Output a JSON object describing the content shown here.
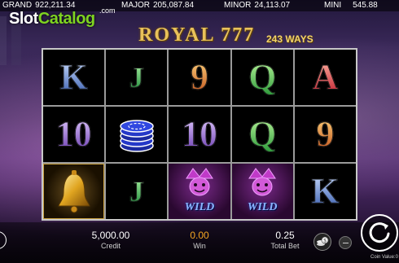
{
  "jackpots": [
    {
      "label": "GRAND",
      "value": "922,211.34"
    },
    {
      "label": "MAJOR",
      "value": "205,087.84"
    },
    {
      "label": "MINOR",
      "value": "24,113.07"
    },
    {
      "label": "MINI",
      "value": "545.88"
    }
  ],
  "logo": {
    "slot": "Slot",
    "catalog": "Catalog",
    "com": ".com"
  },
  "game": {
    "title": "ROYAL 777",
    "ways": "243 WAYS"
  },
  "reels": [
    [
      "K",
      "J",
      "9",
      "Q",
      "A"
    ],
    [
      "10",
      "chips",
      "10",
      "Q",
      "9"
    ],
    [
      "bell",
      "J",
      "WILD",
      "WILD",
      "K"
    ]
  ],
  "wild_label": "WILD",
  "bottom": {
    "credit_value": "5,000.00",
    "credit_label": "Credit",
    "win_value": "0.00",
    "win_label": "Win",
    "bet_value": "0.25",
    "bet_label": "Total Bet",
    "coin_value_label": "Coin Value:0"
  },
  "colors": {
    "win": "#f5a623",
    "logo_accent": "#7ed321",
    "title_gold": "#e8c15a"
  },
  "icons": [
    "coins-icon",
    "minus-icon",
    "spin-icon",
    "menu-arrow-icon",
    "bell-icon",
    "poker-chips-icon",
    "jester-icon"
  ]
}
